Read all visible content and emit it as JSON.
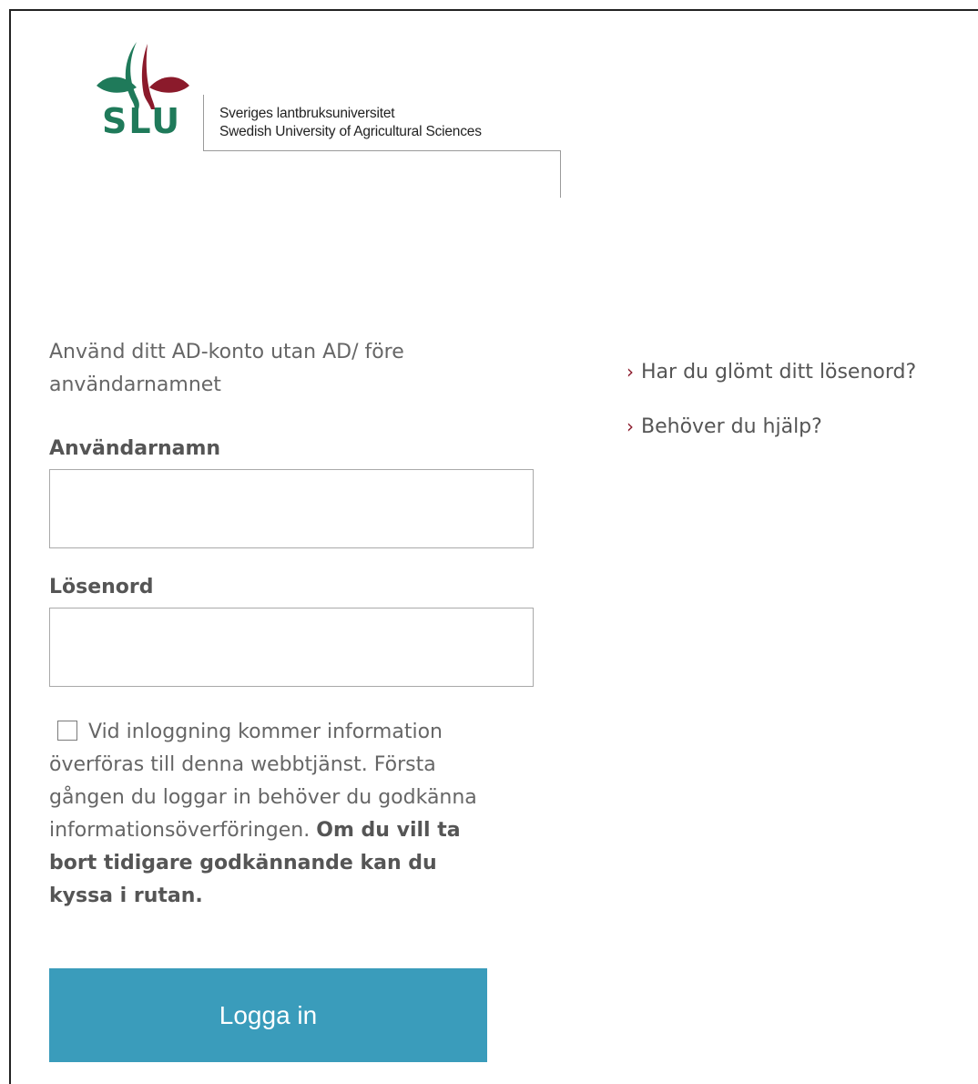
{
  "brand": {
    "logo_text": "SLU",
    "name_sv": "Sveriges lantbruksuniversitet",
    "name_en": "Swedish University of Agricultural Sciences",
    "colors": {
      "green": "#1f7a5a",
      "maroon": "#8b1a2b"
    }
  },
  "form": {
    "intro": "Använd ditt AD-konto utan AD/ före användarnamnet",
    "username_label": "Användarnamn",
    "username_value": "",
    "password_label": "Lösenord",
    "password_value": "",
    "consent_checked": false,
    "consent_text": "Vid inloggning kommer information överföras till denna webbtjänst. Första gången du loggar in behöver du godkänna informationsöverföringen.",
    "consent_bold": "Om du vill ta bort tidigare godkännande kan du kyssa i rutan.",
    "submit_label": "Logga in",
    "button_color": "#3a9cbb"
  },
  "links": [
    {
      "icon": "chevron-right-icon",
      "label": "Har du glömt ditt lösenord?"
    },
    {
      "icon": "chevron-right-icon",
      "label": "Behöver du hjälp?"
    }
  ]
}
